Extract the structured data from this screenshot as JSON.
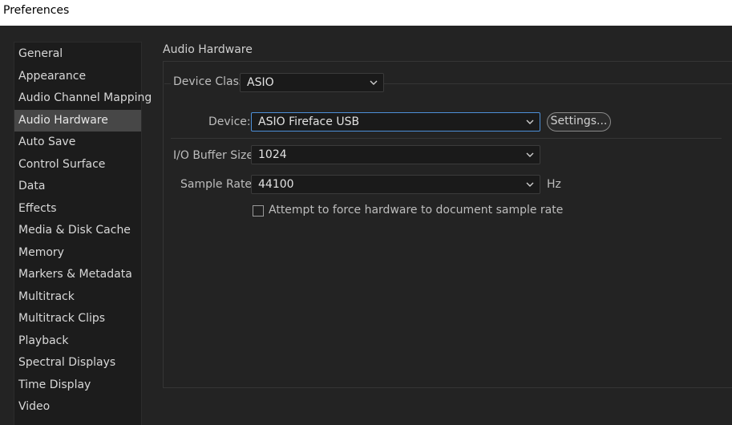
{
  "window": {
    "title": "Preferences"
  },
  "sidebar": {
    "items": [
      {
        "label": "General"
      },
      {
        "label": "Appearance"
      },
      {
        "label": "Audio Channel Mapping"
      },
      {
        "label": "Audio Hardware",
        "selected": true
      },
      {
        "label": "Auto Save"
      },
      {
        "label": "Control Surface"
      },
      {
        "label": "Data"
      },
      {
        "label": "Effects"
      },
      {
        "label": "Media & Disk Cache"
      },
      {
        "label": "Memory"
      },
      {
        "label": "Markers & Metadata"
      },
      {
        "label": "Multitrack"
      },
      {
        "label": "Multitrack Clips"
      },
      {
        "label": "Playback"
      },
      {
        "label": "Spectral Displays"
      },
      {
        "label": "Time Display"
      },
      {
        "label": "Video"
      }
    ]
  },
  "panel": {
    "title": "Audio Hardware",
    "device_class": {
      "label": "Device Class:",
      "value": "ASIO"
    },
    "device": {
      "label": "Device:",
      "value": "ASIO Fireface USB",
      "settings_label": "Settings..."
    },
    "buffer": {
      "label": "I/O Buffer Size:",
      "value": "1024"
    },
    "sample_rate": {
      "label": "Sample Rate:",
      "value": "44100",
      "unit": "Hz"
    },
    "force_rate": {
      "label": "Attempt to force hardware to document sample rate",
      "checked": false
    }
  },
  "icons": {
    "dropdown": "chevron-down-icon"
  },
  "colors": {
    "focus": "#4d8fd8",
    "selected_bg": "#474747"
  }
}
